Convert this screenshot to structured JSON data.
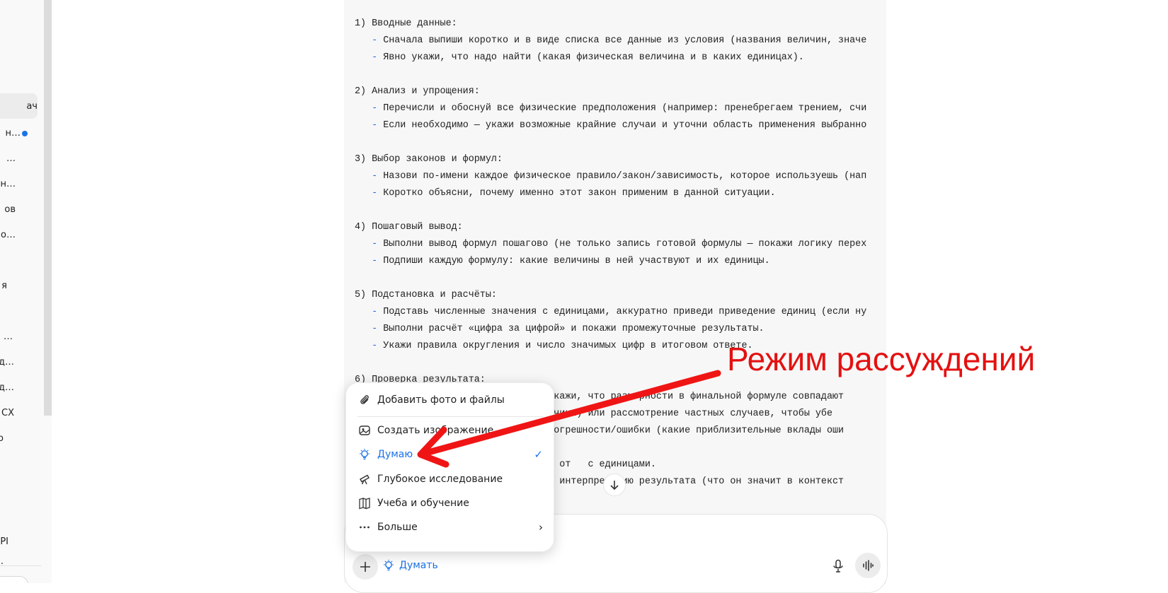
{
  "sidebar": {
    "items": [
      {
        "label": "ач",
        "active": true
      },
      {
        "label": "н…",
        "active": false,
        "dot": true
      },
      {
        "label": "…",
        "active": false
      },
      {
        "label": "н…",
        "active": false
      },
      {
        "label": "ов",
        "active": false
      },
      {
        "label": "о…",
        "active": false
      },
      {
        "label": "я",
        "active": false
      },
      {
        "label": "…",
        "active": false
      },
      {
        "label": "д…",
        "active": false
      },
      {
        "label": "д…",
        "active": false
      },
      {
        "label": "СХ",
        "active": false
      },
      {
        "label": "о",
        "active": false
      },
      {
        "label": "PI",
        "active": false
      },
      {
        "label": ".",
        "active": false
      }
    ]
  },
  "content": {
    "lines": [
      {
        "type": "heading",
        "text": "1) Вводные данные:"
      },
      {
        "type": "bullet",
        "dash": "-",
        "text": "Сначала выпиши коротко и в виде списка все данные из условия (названия величин, значе"
      },
      {
        "type": "bullet",
        "dash": "-",
        "text": "Явно укажи, что надо найти (какая физическая величина и в каких единицах)."
      },
      {
        "type": "blank",
        "text": ""
      },
      {
        "type": "heading",
        "text": "2) Анализ и упрощения:"
      },
      {
        "type": "bullet",
        "dash": "-",
        "text": "Перечисли и обоснуй все физические предположения (например: пренебрегаем трением, счи"
      },
      {
        "type": "bullet",
        "dash": "-",
        "text": "Если необходимо — укажи возможные крайние случаи и уточни область применения выбранно"
      },
      {
        "type": "blank",
        "text": ""
      },
      {
        "type": "heading",
        "text": "3) Выбор законов и формул:"
      },
      {
        "type": "bullet",
        "dash": "-",
        "text": "Назови по-имени каждое физическое правило/закон/зависимость, которое используешь (нап"
      },
      {
        "type": "bullet",
        "dash": "-",
        "text": "Коротко объясни, почему именно этот закон применим в данной ситуации."
      },
      {
        "type": "blank",
        "text": ""
      },
      {
        "type": "heading",
        "text": "4) Пошаговый вывод:"
      },
      {
        "type": "bullet",
        "dash": "-",
        "text": "Выполни вывод формул пошагово (не только запись готовой формулы — покажи логику перех"
      },
      {
        "type": "bullet",
        "dash": "-",
        "text": "Подпиши каждую формулу: какие величины в ней участвуют и их единицы."
      },
      {
        "type": "blank",
        "text": ""
      },
      {
        "type": "heading",
        "text": "5) Подстановка и расчёты:"
      },
      {
        "type": "bullet",
        "dash": "-",
        "text": "Подставь численные значения с единицами, аккуратно приведи приведение единиц (если ну"
      },
      {
        "type": "bullet",
        "dash": "-",
        "text": "Выполни расчёт «цифра за цифрой» и покажи промежуточные результаты."
      },
      {
        "type": "bullet",
        "dash": "-",
        "text": "Укажи правила округления и число значимых цифр в итоговом ответе."
      },
      {
        "type": "blank",
        "text": ""
      },
      {
        "type": "heading",
        "text": "6) Проверка результата:"
      },
      {
        "type": "bullet",
        "dash": "",
        "text": "                          ку (покажи, что размерности в финальной формуле совпадают"
      },
      {
        "type": "bullet",
        "dash": "",
        "text": "                          к величины) или рассмотрение частных случаев, чтобы убе"
      },
      {
        "type": "bullet",
        "dash": "",
        "text": "                          кажи погрешности/ошибки (какие приблизительные вклады оши"
      },
      {
        "type": "blank",
        "text": ""
      },
      {
        "type": "bullet",
        "dash": "",
        "text": "                          ельный от   с единицами."
      },
      {
        "type": "bullet",
        "dash": "",
        "text": "                          ческую интерпретацию результата (что он значит в контекст"
      }
    ]
  },
  "menu": {
    "items": [
      {
        "name": "add-files",
        "label": "Добавить фото и файлы",
        "icon": "paperclip-icon"
      },
      {
        "name": "create-image",
        "label": "Создать изображение",
        "icon": "image-icon"
      },
      {
        "name": "thinking",
        "label": "Думаю",
        "icon": "lightbulb-icon",
        "selected": true,
        "check": "✓"
      },
      {
        "name": "deep-research",
        "label": "Глубокое исследование",
        "icon": "telescope-icon"
      },
      {
        "name": "study",
        "label": "Учеба и обучение",
        "icon": "book-icon"
      },
      {
        "name": "more",
        "label": "Больше",
        "icon": "dots-icon",
        "arrow": "›"
      }
    ]
  },
  "composer": {
    "plus": "+",
    "think_label": "Думать"
  },
  "annotation": {
    "label": "Режим рассуждений",
    "color": "#e41111"
  },
  "colors": {
    "accent": "#1a73e8",
    "content_bg": "#f7f7f7"
  }
}
